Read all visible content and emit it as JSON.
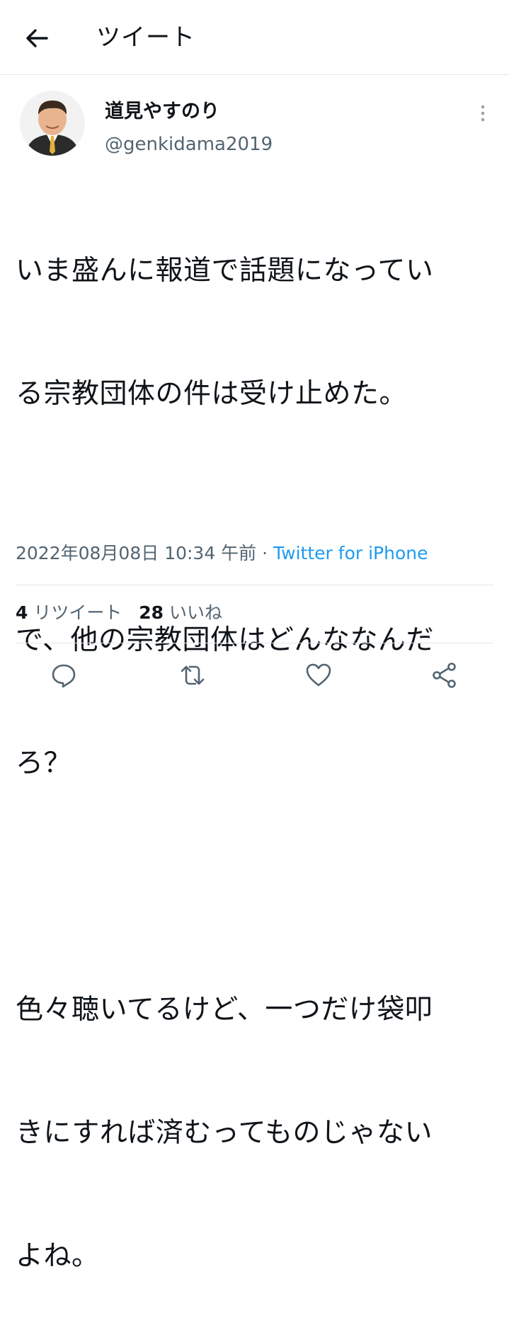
{
  "header": {
    "title": "ツイート",
    "back_icon": "arrow-left-icon"
  },
  "author": {
    "name": "道見やすのり",
    "handle": "@genkidama2019",
    "avatar_icon": "avatar"
  },
  "tweet": {
    "lines": [
      "いま盛んに報道で話題になってい",
      "る宗教団体の件は受け止めた。",
      "",
      "で、他の宗教団体はどんななんだ",
      "ろ？",
      "",
      "色々聴いてるけど、一つだけ袋叩",
      "きにすれば済むってものじゃない",
      "よね。"
    ]
  },
  "meta": {
    "datetime": "2022年08月08日 10:34 午前",
    "separator": " · ",
    "source": "Twitter for iPhone"
  },
  "stats": {
    "retweets_count": "4",
    "retweets_label": "リツイート",
    "likes_count": "28",
    "likes_label": "いいね"
  },
  "actions": {
    "icons": [
      "reply-icon",
      "retweet-icon",
      "like-icon",
      "share-icon"
    ]
  },
  "colors": {
    "text": "#0f1419",
    "secondary": "#536471",
    "link": "#1d9bf0",
    "divider": "#e6e6e6"
  }
}
